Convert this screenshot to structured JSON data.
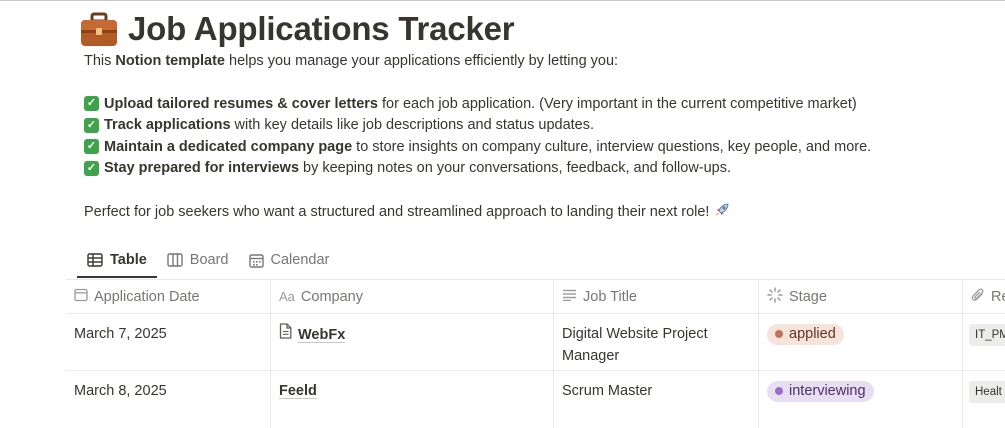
{
  "page": {
    "title": "Job Applications Tracker",
    "icon": "briefcase-icon",
    "intro_prefix": "This ",
    "intro_bold": "Notion template",
    "intro_suffix": " helps you manage your applications efficiently by letting you:",
    "bullets": [
      {
        "bold": "Upload tailored resumes & cover letters",
        "text": "for each job application. (Very important in the current competitive market)"
      },
      {
        "bold": "Track applications",
        "text": "with key details like job descriptions and status updates."
      },
      {
        "bold": "Maintain a dedicated company page",
        "text": "to store insights on company culture, interview questions, key people, and more."
      },
      {
        "bold": "Stay prepared for interviews",
        "text": "by keeping notes on your conversations, feedback, and follow-ups."
      }
    ],
    "outro": "Perfect for job seekers who want a structured and streamlined approach to landing their next role!",
    "outro_emoji": "rocket-icon"
  },
  "views": {
    "tabs": [
      {
        "label": "Table",
        "icon": "table-icon",
        "active": true
      },
      {
        "label": "Board",
        "icon": "board-icon",
        "active": false
      },
      {
        "label": "Calendar",
        "icon": "calendar-icon",
        "active": false
      }
    ]
  },
  "table": {
    "columns": [
      {
        "label": "Application Date",
        "icon": "calendar-icon"
      },
      {
        "label": "Company",
        "icon": "text-icon"
      },
      {
        "label": "Job Title",
        "icon": "list-icon"
      },
      {
        "label": "Stage",
        "icon": "status-icon"
      },
      {
        "label": "Re",
        "icon": "paperclip-icon"
      }
    ],
    "rows": [
      {
        "date": "March 7, 2025",
        "company": "WebFx",
        "company_icon": "page-icon",
        "job_title": "Digital Website Project Manager",
        "stage": "applied",
        "file": "IT_PM"
      },
      {
        "date": "March 8, 2025",
        "company": "Feeld",
        "company_icon": "",
        "job_title": "Scrum Master",
        "stage": "interviewing",
        "file": "Healt"
      }
    ]
  },
  "colors": {
    "text": "#37352f",
    "muted": "#787774",
    "check": "#3ea34b",
    "applied_bg": "#f6e3da",
    "applied_dot": "#c0735a",
    "interviewing_bg": "#e8def3",
    "interviewing_dot": "#9a6dc8",
    "border": "#e9e9e7"
  }
}
